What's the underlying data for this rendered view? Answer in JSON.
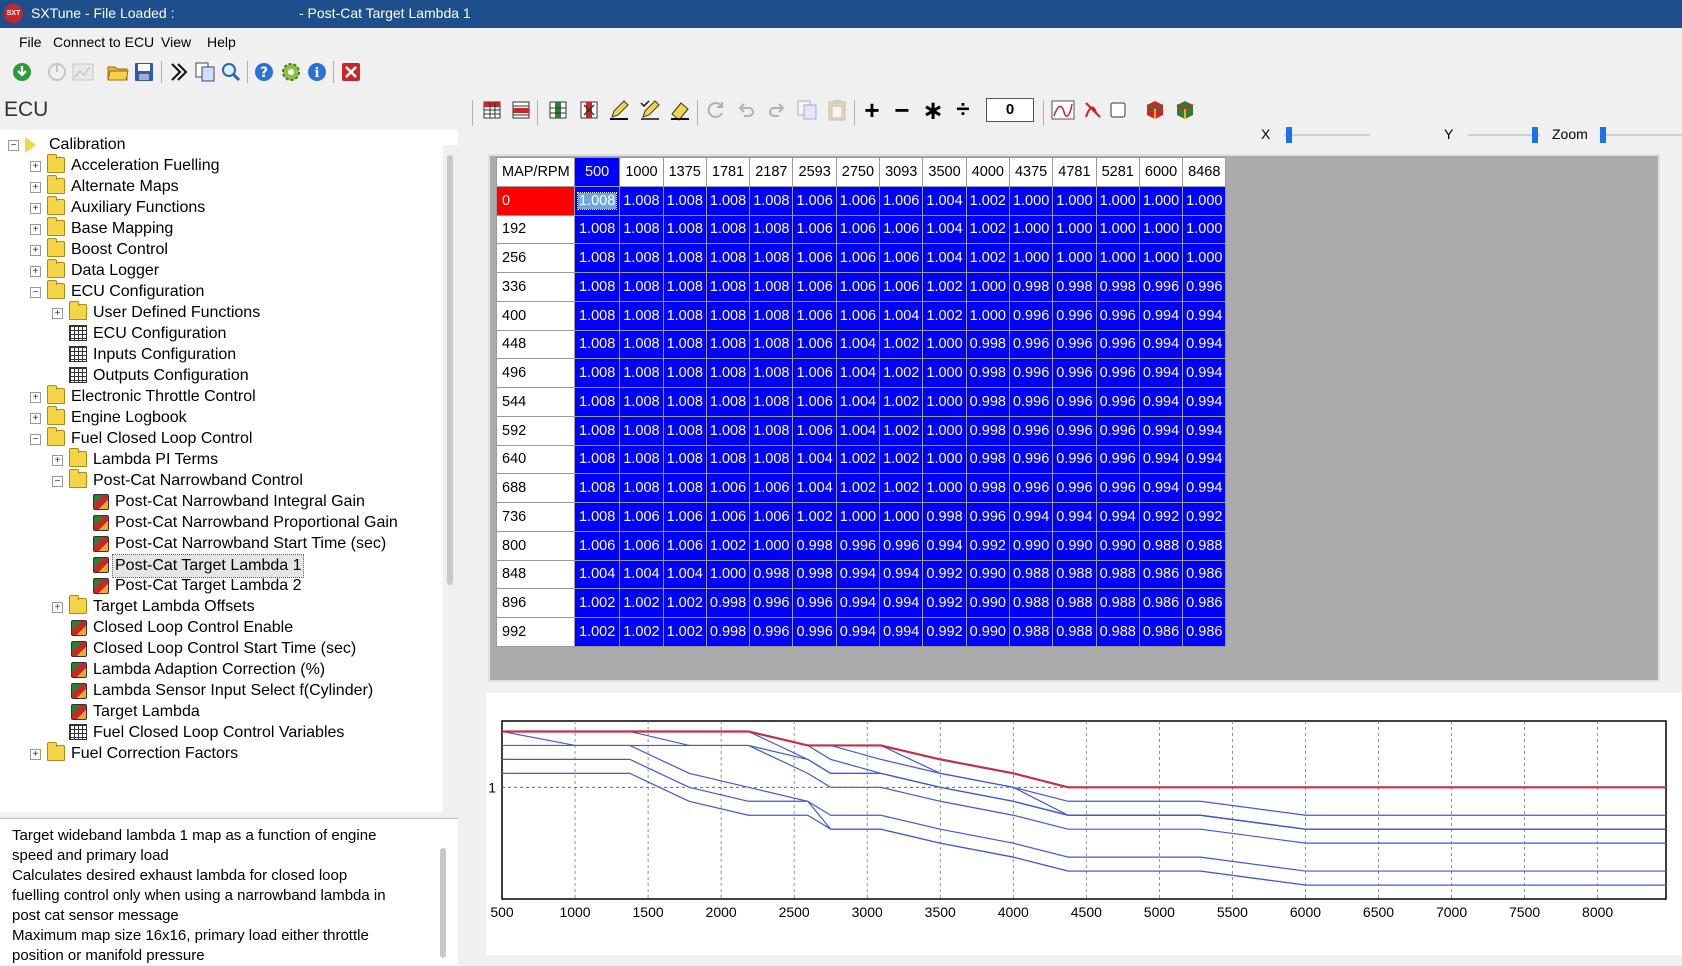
{
  "window": {
    "title_left": "SXTune - File Loaded :",
    "title_right": "- Post-Cat Target Lambda 1",
    "app_icon_text": "SXT"
  },
  "menu": [
    "File",
    "Connect to ECU",
    "View",
    "Help"
  ],
  "toolbar": {
    "icons": [
      "connect-icon",
      "disconnect-icon",
      "chart-icon",
      "open-folder-icon",
      "save-icon",
      "goto-icon",
      "copy-icon",
      "search-icon",
      "help-icon",
      "settings-icon",
      "info-icon",
      "close-icon"
    ]
  },
  "ecu_panel": {
    "title": "ECU",
    "tree": [
      {
        "label": "Calibration",
        "level": 0,
        "type": "calibration",
        "expander": "-"
      },
      {
        "label": "Acceleration Fuelling",
        "level": 1,
        "type": "folder",
        "expander": "+"
      },
      {
        "label": "Alternate Maps",
        "level": 1,
        "type": "folder",
        "expander": "+"
      },
      {
        "label": "Auxiliary Functions",
        "level": 1,
        "type": "folder",
        "expander": "+"
      },
      {
        "label": "Base Mapping",
        "level": 1,
        "type": "folder",
        "expander": "+"
      },
      {
        "label": "Boost Control",
        "level": 1,
        "type": "folder",
        "expander": "+"
      },
      {
        "label": "Data Logger",
        "level": 1,
        "type": "folder",
        "expander": "+"
      },
      {
        "label": "ECU Configuration",
        "level": 1,
        "type": "folder",
        "expander": "-"
      },
      {
        "label": "User Defined Functions",
        "level": 2,
        "type": "folder",
        "expander": "+"
      },
      {
        "label": "ECU Configuration",
        "level": 2,
        "type": "grid",
        "expander": ""
      },
      {
        "label": "Inputs Configuration",
        "level": 2,
        "type": "grid",
        "expander": ""
      },
      {
        "label": "Outputs Configuration",
        "level": 2,
        "type": "grid",
        "expander": ""
      },
      {
        "label": "Electronic Throttle Control",
        "level": 1,
        "type": "folder",
        "expander": "+"
      },
      {
        "label": "Engine Logbook",
        "level": 1,
        "type": "folder",
        "expander": "+"
      },
      {
        "label": "Fuel Closed Loop Control",
        "level": 1,
        "type": "folder",
        "expander": "-"
      },
      {
        "label": "Lambda PI Terms",
        "level": 2,
        "type": "folder",
        "expander": "+"
      },
      {
        "label": "Post-Cat Narrowband Control",
        "level": 2,
        "type": "folder",
        "expander": "-"
      },
      {
        "label": "Post-Cat Narrowband Integral Gain",
        "level": 3,
        "type": "cube",
        "expander": ""
      },
      {
        "label": "Post-Cat Narrowband Proportional Gain",
        "level": 3,
        "type": "cube",
        "expander": ""
      },
      {
        "label": "Post-Cat Narrowband Start Time (sec)",
        "level": 3,
        "type": "cube",
        "expander": ""
      },
      {
        "label": "Post-Cat Target Lambda 1",
        "level": 3,
        "type": "cube",
        "expander": "",
        "selected": true
      },
      {
        "label": "Post-Cat Target Lambda 2",
        "level": 3,
        "type": "cube",
        "expander": ""
      },
      {
        "label": "Target Lambda Offsets",
        "level": 2,
        "type": "folder",
        "expander": "+"
      },
      {
        "label": "Closed Loop Control Enable",
        "level": 2,
        "type": "cube",
        "expander": ""
      },
      {
        "label": "Closed Loop Control Start Time (sec)",
        "level": 2,
        "type": "cube",
        "expander": ""
      },
      {
        "label": "Lambda Adaption Correction (%)",
        "level": 2,
        "type": "cube",
        "expander": ""
      },
      {
        "label": "Lambda Sensor Input Select f(Cylinder)",
        "level": 2,
        "type": "cube",
        "expander": ""
      },
      {
        "label": "Target Lambda",
        "level": 2,
        "type": "cube",
        "expander": ""
      },
      {
        "label": "Fuel Closed Loop Control Variables",
        "level": 2,
        "type": "grid",
        "expander": ""
      },
      {
        "label": "Fuel Correction Factors",
        "level": 1,
        "type": "folder",
        "expander": "+"
      }
    ],
    "description": [
      "Target wideband lambda 1 map as a function of engine",
      "speed and primary load",
      "Calculates desired exhaust lambda for closed loop",
      "fuelling control only when using a narrowband lambda in",
      "post cat sensor message",
      "Maximum map size 16x16, primary load either throttle",
      "position or manifold pressure"
    ]
  },
  "map_toolbar": {
    "value": "0",
    "op_plus": "+",
    "op_minus": "−",
    "op_multiply": "∗",
    "op_divide": "÷",
    "x_label": "X",
    "y_label": "Y",
    "zoom_label": "Zoom",
    "x_slider": 0.03,
    "y_slider": 0.97,
    "zoom_slider": 0.0
  },
  "map_table": {
    "corner": "MAP/RPM",
    "rpm": [
      "500",
      "1000",
      "1375",
      "1781",
      "2187",
      "2593",
      "2750",
      "3093",
      "3500",
      "4000",
      "4375",
      "4781",
      "5281",
      "6000",
      "8468"
    ],
    "selected_column": 0,
    "selected_row": 0,
    "rows": [
      {
        "map": "0",
        "values": [
          "1.008",
          "1.008",
          "1.008",
          "1.008",
          "1.008",
          "1.006",
          "1.006",
          "1.006",
          "1.004",
          "1.002",
          "1.000",
          "1.000",
          "1.000",
          "1.000",
          "1.000"
        ]
      },
      {
        "map": "192",
        "values": [
          "1.008",
          "1.008",
          "1.008",
          "1.008",
          "1.008",
          "1.006",
          "1.006",
          "1.006",
          "1.004",
          "1.002",
          "1.000",
          "1.000",
          "1.000",
          "1.000",
          "1.000"
        ]
      },
      {
        "map": "256",
        "values": [
          "1.008",
          "1.008",
          "1.008",
          "1.008",
          "1.008",
          "1.006",
          "1.006",
          "1.006",
          "1.004",
          "1.002",
          "1.000",
          "1.000",
          "1.000",
          "1.000",
          "1.000"
        ]
      },
      {
        "map": "336",
        "values": [
          "1.008",
          "1.008",
          "1.008",
          "1.008",
          "1.008",
          "1.006",
          "1.006",
          "1.006",
          "1.002",
          "1.000",
          "0.998",
          "0.998",
          "0.998",
          "0.996",
          "0.996"
        ]
      },
      {
        "map": "400",
        "values": [
          "1.008",
          "1.008",
          "1.008",
          "1.008",
          "1.008",
          "1.006",
          "1.006",
          "1.004",
          "1.002",
          "1.000",
          "0.996",
          "0.996",
          "0.996",
          "0.994",
          "0.994"
        ]
      },
      {
        "map": "448",
        "values": [
          "1.008",
          "1.008",
          "1.008",
          "1.008",
          "1.008",
          "1.006",
          "1.004",
          "1.002",
          "1.000",
          "0.998",
          "0.996",
          "0.996",
          "0.996",
          "0.994",
          "0.994"
        ]
      },
      {
        "map": "496",
        "values": [
          "1.008",
          "1.008",
          "1.008",
          "1.008",
          "1.008",
          "1.006",
          "1.004",
          "1.002",
          "1.000",
          "0.998",
          "0.996",
          "0.996",
          "0.996",
          "0.994",
          "0.994"
        ]
      },
      {
        "map": "544",
        "values": [
          "1.008",
          "1.008",
          "1.008",
          "1.008",
          "1.008",
          "1.006",
          "1.004",
          "1.002",
          "1.000",
          "0.998",
          "0.996",
          "0.996",
          "0.996",
          "0.994",
          "0.994"
        ]
      },
      {
        "map": "592",
        "values": [
          "1.008",
          "1.008",
          "1.008",
          "1.008",
          "1.008",
          "1.006",
          "1.004",
          "1.002",
          "1.000",
          "0.998",
          "0.996",
          "0.996",
          "0.996",
          "0.994",
          "0.994"
        ]
      },
      {
        "map": "640",
        "values": [
          "1.008",
          "1.008",
          "1.008",
          "1.008",
          "1.008",
          "1.004",
          "1.002",
          "1.002",
          "1.000",
          "0.998",
          "0.996",
          "0.996",
          "0.996",
          "0.994",
          "0.994"
        ]
      },
      {
        "map": "688",
        "values": [
          "1.008",
          "1.008",
          "1.008",
          "1.006",
          "1.006",
          "1.004",
          "1.002",
          "1.002",
          "1.000",
          "0.998",
          "0.996",
          "0.996",
          "0.996",
          "0.994",
          "0.994"
        ]
      },
      {
        "map": "736",
        "values": [
          "1.008",
          "1.006",
          "1.006",
          "1.006",
          "1.006",
          "1.002",
          "1.000",
          "1.000",
          "0.998",
          "0.996",
          "0.994",
          "0.994",
          "0.994",
          "0.992",
          "0.992"
        ]
      },
      {
        "map": "800",
        "values": [
          "1.006",
          "1.006",
          "1.006",
          "1.002",
          "1.000",
          "0.998",
          "0.996",
          "0.996",
          "0.994",
          "0.992",
          "0.990",
          "0.990",
          "0.990",
          "0.988",
          "0.988"
        ]
      },
      {
        "map": "848",
        "values": [
          "1.004",
          "1.004",
          "1.004",
          "1.000",
          "0.998",
          "0.998",
          "0.994",
          "0.994",
          "0.992",
          "0.990",
          "0.988",
          "0.988",
          "0.988",
          "0.986",
          "0.986"
        ]
      },
      {
        "map": "896",
        "values": [
          "1.002",
          "1.002",
          "1.002",
          "0.998",
          "0.996",
          "0.996",
          "0.994",
          "0.994",
          "0.992",
          "0.990",
          "0.988",
          "0.988",
          "0.988",
          "0.986",
          "0.986"
        ]
      },
      {
        "map": "992",
        "values": [
          "1.002",
          "1.002",
          "1.002",
          "0.998",
          "0.996",
          "0.996",
          "0.994",
          "0.994",
          "0.992",
          "0.990",
          "0.988",
          "0.988",
          "0.988",
          "0.986",
          "0.986"
        ]
      }
    ]
  },
  "chart_data": {
    "type": "line",
    "x": [
      500,
      1000,
      1375,
      1781,
      2187,
      2593,
      2750,
      3093,
      3500,
      4000,
      4375,
      4781,
      5281,
      6000,
      8468
    ],
    "xlim": [
      500,
      8468
    ],
    "x_ticks": [
      "500",
      "1000",
      "1500",
      "2000",
      "2500",
      "3000",
      "3500",
      "4000",
      "4500",
      "5000",
      "5500",
      "6000",
      "6500",
      "7000",
      "7500",
      "8000"
    ],
    "y_ticks": [
      "1"
    ],
    "ylim": [
      0.984,
      1.0095
    ],
    "grid": true,
    "highlight_series": 0,
    "colors": {
      "series": "#3c5bd6",
      "highlight": "#c0304a",
      "reference": "#555555"
    },
    "series": [
      {
        "values": [
          1.008,
          1.008,
          1.008,
          1.008,
          1.008,
          1.006,
          1.006,
          1.006,
          1.004,
          1.002,
          1.0,
          1.0,
          1.0,
          1.0,
          1.0
        ]
      },
      {
        "values": [
          1.008,
          1.008,
          1.008,
          1.008,
          1.008,
          1.006,
          1.006,
          1.006,
          1.002,
          1.0,
          0.998,
          0.998,
          0.998,
          0.996,
          0.996
        ]
      },
      {
        "values": [
          1.008,
          1.008,
          1.008,
          1.008,
          1.008,
          1.006,
          1.006,
          1.004,
          1.002,
          1.0,
          0.996,
          0.996,
          0.996,
          0.994,
          0.994
        ]
      },
      {
        "values": [
          1.008,
          1.008,
          1.008,
          1.008,
          1.008,
          1.006,
          1.004,
          1.002,
          1.0,
          0.998,
          0.996,
          0.996,
          0.996,
          0.994,
          0.994
        ]
      },
      {
        "values": [
          1.008,
          1.008,
          1.008,
          1.008,
          1.008,
          1.004,
          1.002,
          1.002,
          1.0,
          0.998,
          0.996,
          0.996,
          0.996,
          0.994,
          0.994
        ]
      },
      {
        "values": [
          1.008,
          1.008,
          1.008,
          1.006,
          1.006,
          1.004,
          1.002,
          1.002,
          1.0,
          0.998,
          0.996,
          0.996,
          0.996,
          0.994,
          0.994
        ]
      },
      {
        "values": [
          1.008,
          1.006,
          1.006,
          1.006,
          1.006,
          1.002,
          1.0,
          1.0,
          0.998,
          0.996,
          0.994,
          0.994,
          0.994,
          0.992,
          0.992
        ]
      },
      {
        "values": [
          1.006,
          1.006,
          1.006,
          1.002,
          1.0,
          0.998,
          0.996,
          0.996,
          0.994,
          0.992,
          0.99,
          0.99,
          0.99,
          0.988,
          0.988
        ]
      },
      {
        "values": [
          1.004,
          1.004,
          1.004,
          1.0,
          0.998,
          0.998,
          0.994,
          0.994,
          0.992,
          0.99,
          0.988,
          0.988,
          0.988,
          0.986,
          0.986
        ]
      },
      {
        "values": [
          1.002,
          1.002,
          1.002,
          0.998,
          0.996,
          0.996,
          0.994,
          0.994,
          0.992,
          0.99,
          0.988,
          0.988,
          0.988,
          0.986,
          0.986
        ]
      }
    ]
  }
}
